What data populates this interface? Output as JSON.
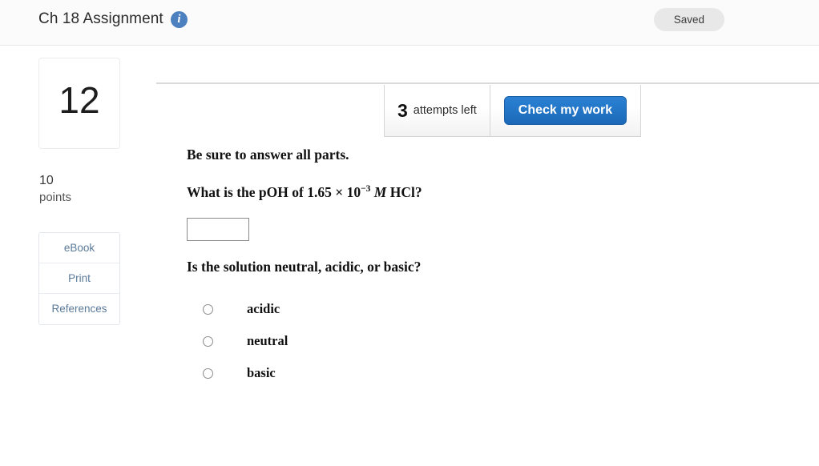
{
  "header": {
    "title": "Ch 18 Assignment",
    "info_icon": "info-icon",
    "save_status": "Saved"
  },
  "sidebar": {
    "question_number": "12",
    "points_value": "10",
    "points_label": "points",
    "tools": [
      {
        "label": "eBook",
        "name": "ebook-button"
      },
      {
        "label": "Print",
        "name": "print-button"
      },
      {
        "label": "References",
        "name": "references-button"
      }
    ]
  },
  "toolbar": {
    "attempts_count": "3",
    "attempts_text": "attempts left",
    "check_label": "Check my work"
  },
  "question": {
    "instruction": "Be sure to answer all parts.",
    "prompt_prefix": "What is the pOH of 1.65 × 10",
    "prompt_exponent": "−3",
    "prompt_unit": "M",
    "prompt_suffix": "HCl?",
    "answer_value": "",
    "answer_placeholder": "",
    "subprompt": "Is the solution neutral, acidic, or basic?",
    "options": [
      {
        "label": "acidic",
        "selected": false
      },
      {
        "label": "neutral",
        "selected": false
      },
      {
        "label": "basic",
        "selected": false
      }
    ]
  },
  "colors": {
    "accent_blue": "#1f72c4",
    "info_blue": "#4d80bf",
    "badge_gray": "#e8e8e8",
    "tool_text": "#5b7a99"
  }
}
